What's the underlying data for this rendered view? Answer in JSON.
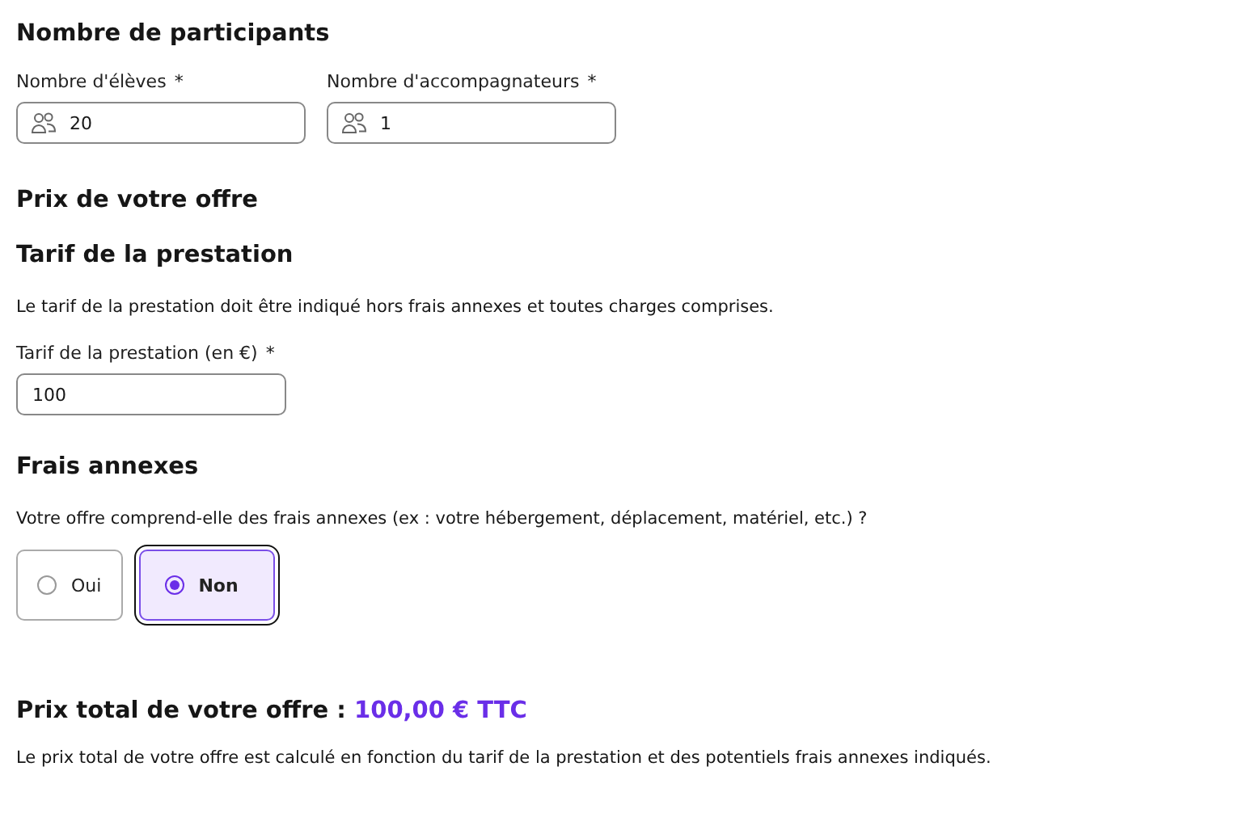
{
  "participants": {
    "title": "Nombre de participants",
    "fields": [
      {
        "label": "Nombre d'élèves",
        "required_mark": "*",
        "value": "20",
        "kind": "people"
      },
      {
        "label": "Nombre d'accompagnateurs",
        "required_mark": "*",
        "value": "1",
        "kind": "people"
      }
    ]
  },
  "offer": {
    "title": "Prix de votre offre"
  },
  "tariff": {
    "title": "Tarif de la prestation",
    "description": "Le tarif de la prestation doit être indiqué hors frais annexes et toutes charges comprises.",
    "field": {
      "label": "Tarif de la prestation (en €)",
      "required_mark": "*",
      "value": "100",
      "kind": "plain"
    }
  },
  "extras": {
    "title": "Frais annexes",
    "question": "Votre offre comprend-elle des frais annexes (ex : votre hébergement, déplacement, matériel, etc.) ?",
    "options": [
      {
        "label": "Oui",
        "selected": false,
        "focused": false
      },
      {
        "label": "Non",
        "selected": true,
        "focused": true
      }
    ]
  },
  "total": {
    "label": "Prix total de votre offre :",
    "amount": "100,00 € TTC",
    "description": "Le prix total de votre offre est calculé en fonction du tarif de la prestation et des potentiels frais annexes indiqués."
  }
}
